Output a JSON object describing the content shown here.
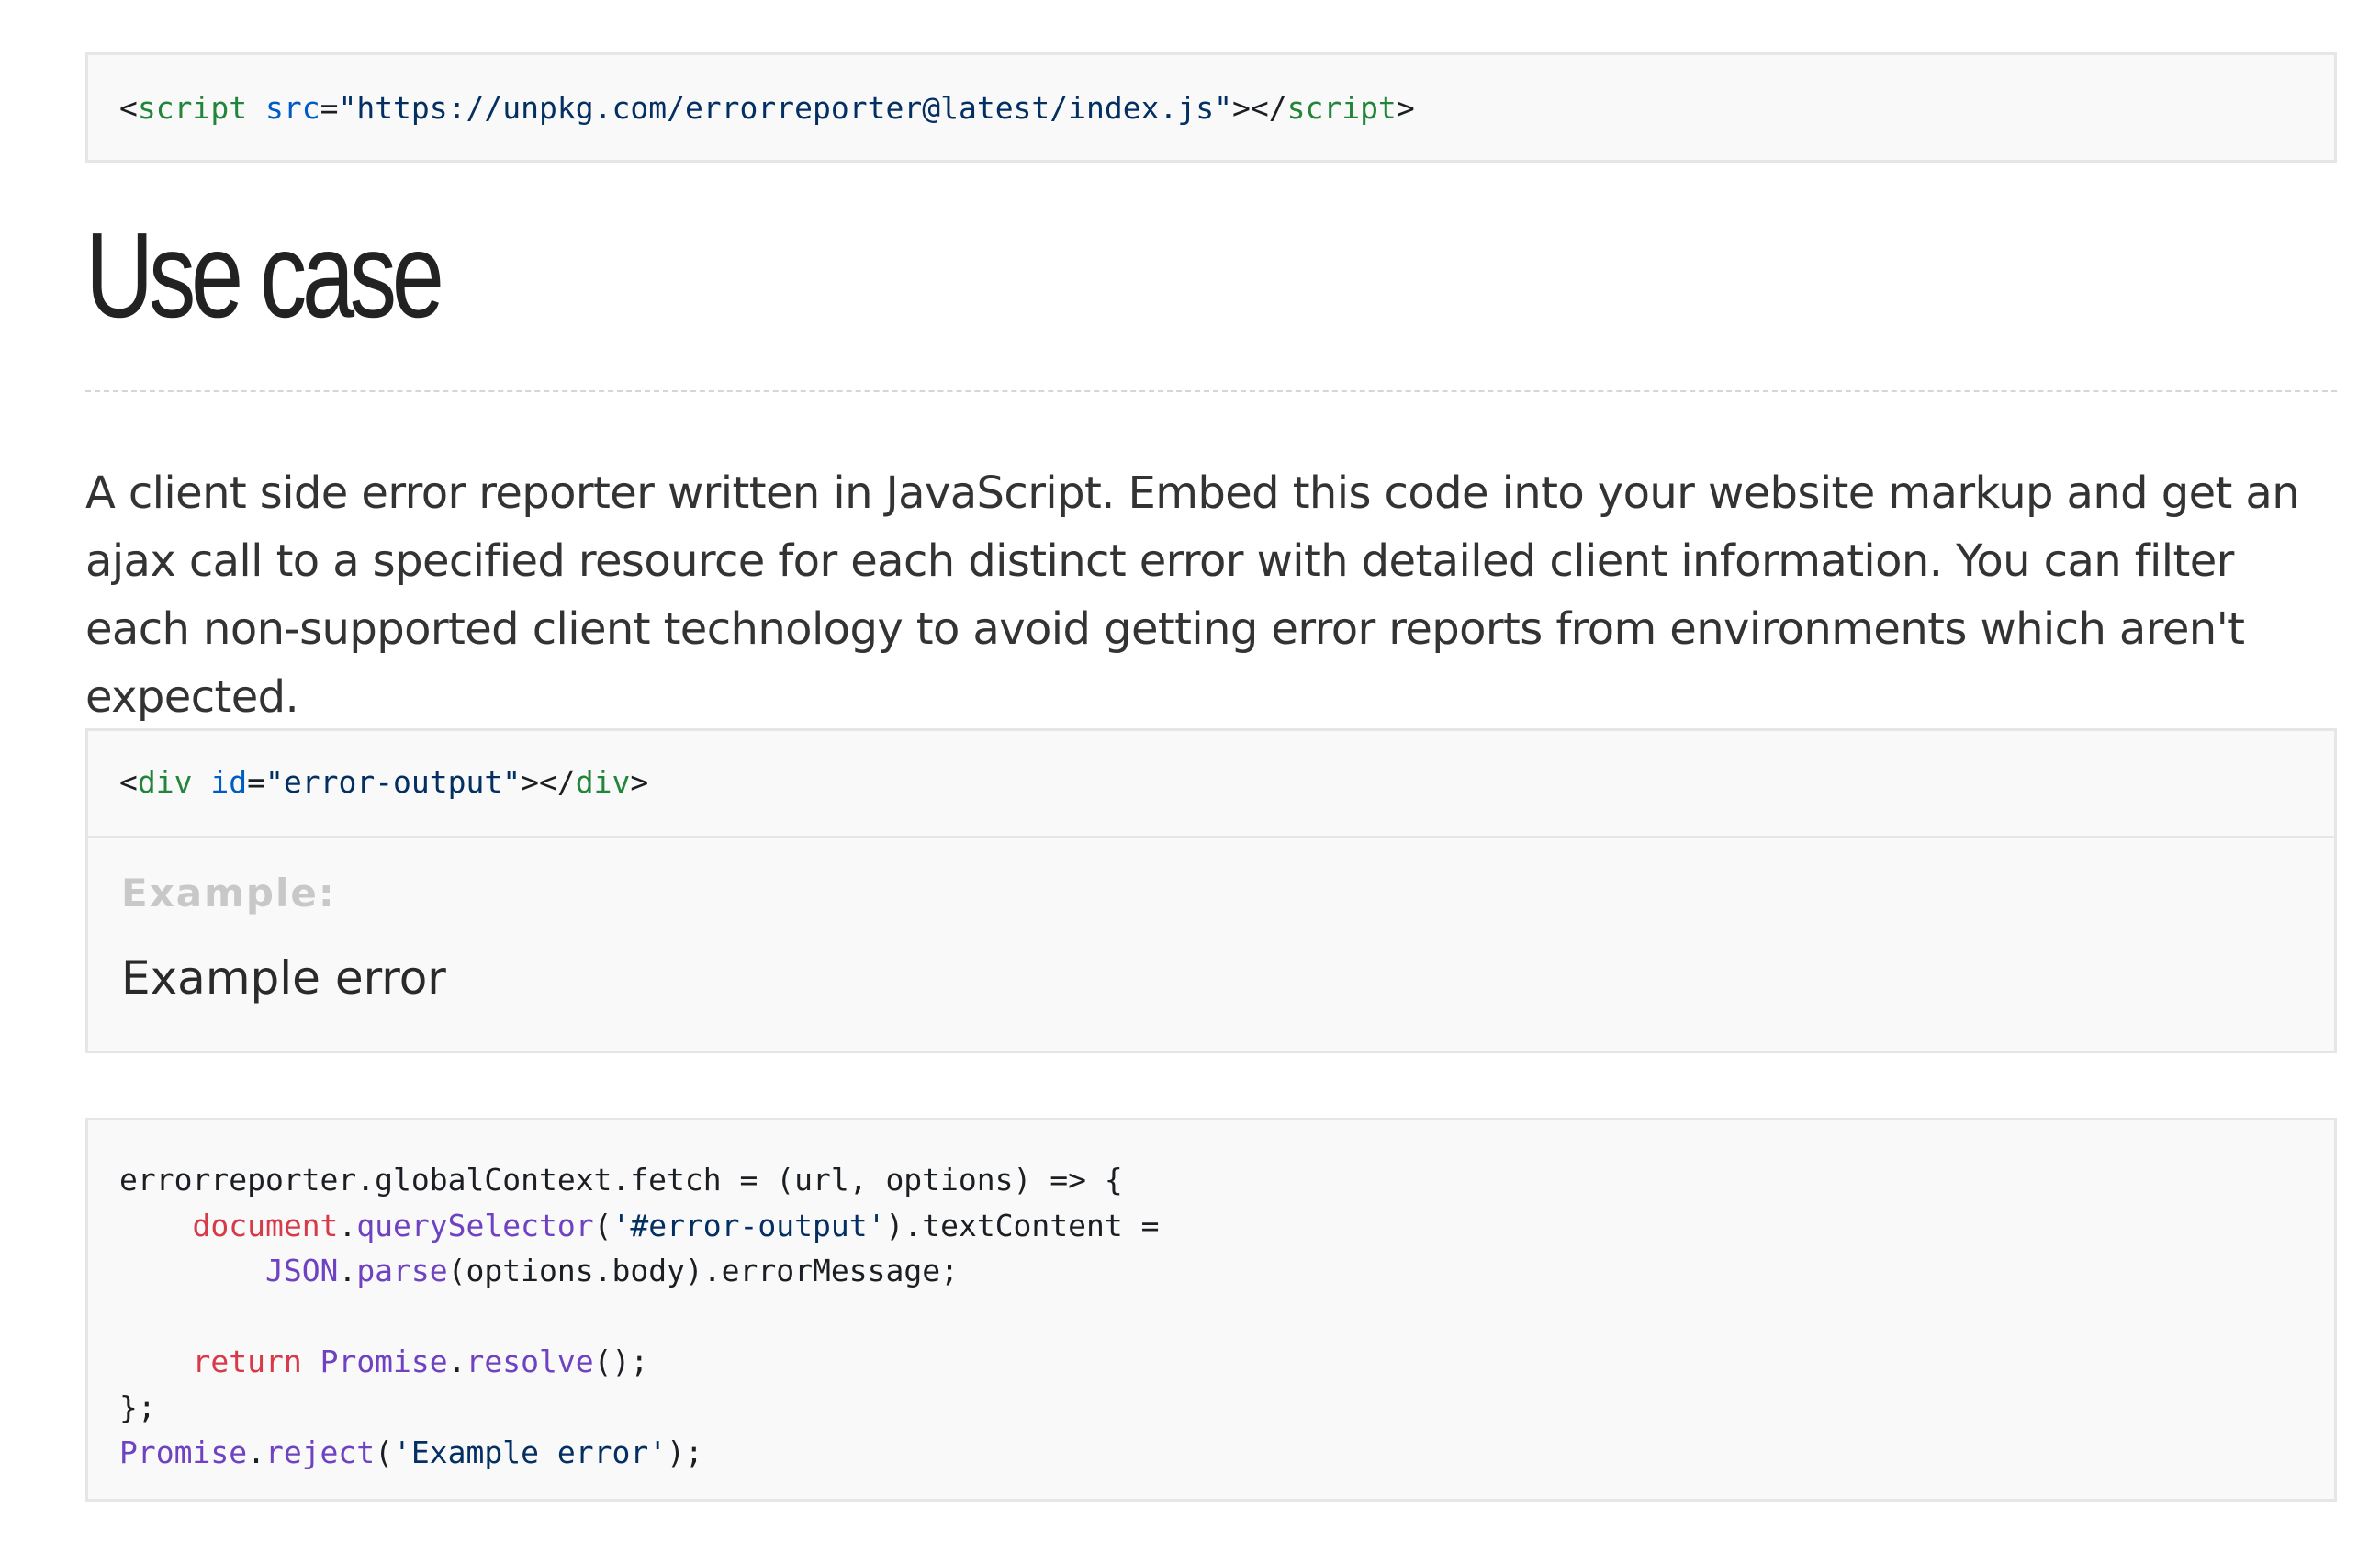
{
  "install_snippet": {
    "open_lt": "<",
    "tag": "script",
    "attr": "src",
    "eq": "=",
    "value": "\"https://unpkg.com/errorreporter@latest/index.js\"",
    "close_open": "></",
    "close_tag": "script",
    "close_gt": ">"
  },
  "heading": "Use case",
  "paragraph": "A client side error reporter written in JavaScript. Embed this code into your website markup and get an ajax call to a specified resource for each distinct error with detailed client information. You can filter each non-supported client technology to avoid getting error reports from environments which aren't expected.",
  "demo": {
    "markup": {
      "open_lt": "<",
      "tag": "div",
      "attr": "id",
      "eq": "=",
      "value": "\"error-output\"",
      "close_open": "></",
      "close_tag": "div",
      "close_gt": ">"
    },
    "label": "Example:",
    "result": "Example error"
  },
  "code": {
    "l1": "errorreporter.globalContext.fetch = (url, options) => {",
    "l2_indent": "    ",
    "l2_obj": "document",
    "l2_dot": ".",
    "l2_fn": "querySelector",
    "l2_open": "(",
    "l2_str": "'#error-output'",
    "l2_rest": ").textContent =",
    "l3_indent": "        ",
    "l3_obj": "JSON",
    "l3_dot": ".",
    "l3_fn": "parse",
    "l3_rest": "(options.body).errorMessage;",
    "l5_indent": "    ",
    "l5_kw": "return",
    "l5_sp": " ",
    "l5_obj": "Promise",
    "l5_dot": ".",
    "l5_fn": "resolve",
    "l5_rest": "();",
    "l6": "};",
    "l7_obj": "Promise",
    "l7_dot": ".",
    "l7_fn": "reject",
    "l7_open": "(",
    "l7_str": "'Example error'",
    "l7_rest": ");"
  },
  "colors": {
    "tag": "#22863a",
    "attribute": "#005cc5",
    "string": "#032f62",
    "keyword": "#d73a49",
    "entity": "#6f42c1",
    "box_background": "#f9f9f9",
    "box_border": "#e6e6e6"
  }
}
